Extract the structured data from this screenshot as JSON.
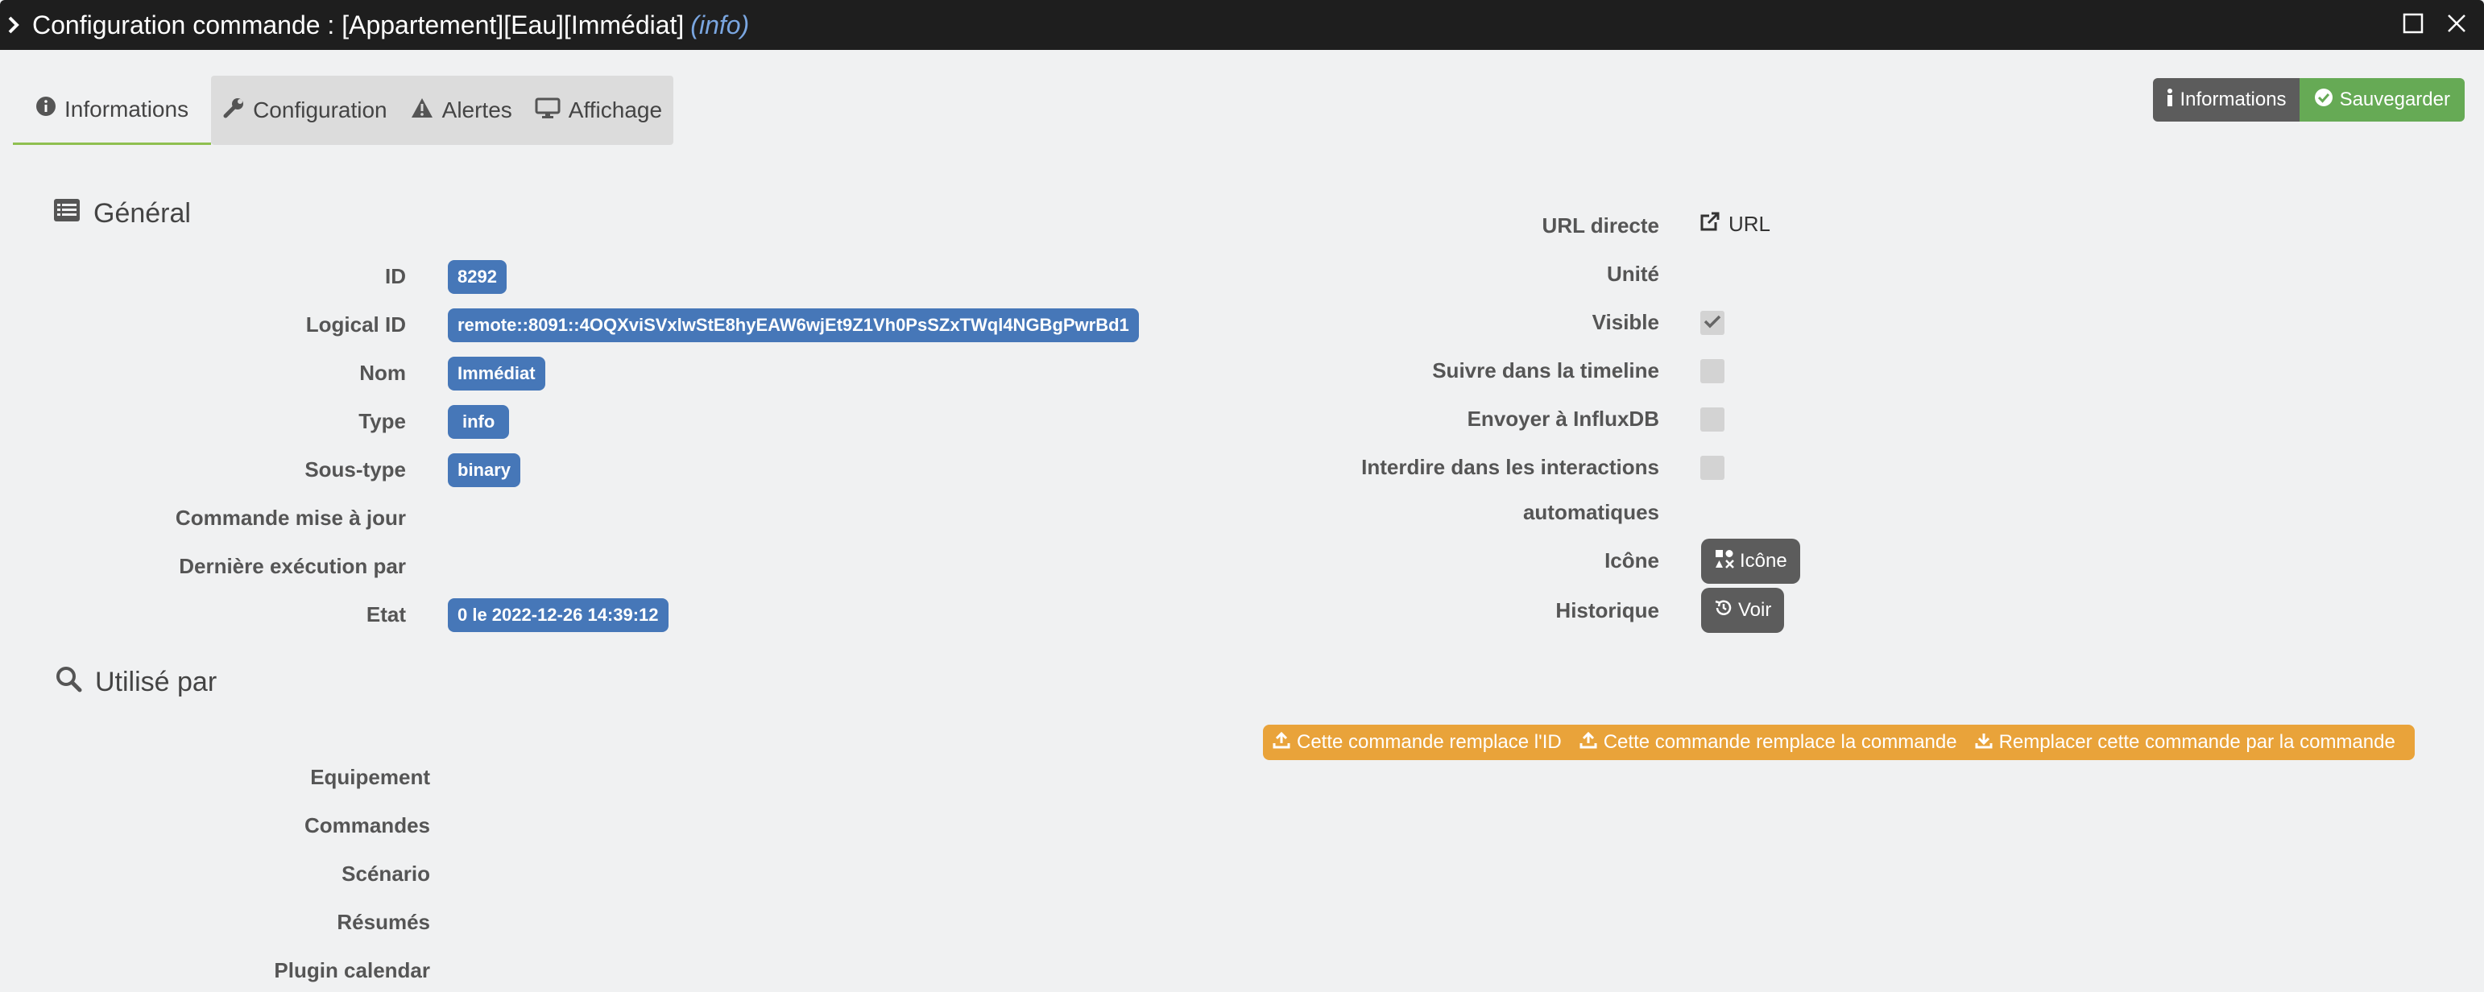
{
  "window": {
    "title": "Configuration commande : [Appartement][Eau][Immédiat]",
    "subtype": "(info)"
  },
  "tabs": [
    {
      "label": "Informations",
      "icon": "info-circle-icon"
    },
    {
      "label": "Configuration",
      "icon": "wrench-icon"
    },
    {
      "label": "Alertes",
      "icon": "warning-icon"
    },
    {
      "label": "Affichage",
      "icon": "monitor-icon"
    }
  ],
  "actions": {
    "info_label": "Informations",
    "save_label": "Sauvegarder"
  },
  "general": {
    "title": "Général",
    "fields": [
      {
        "label": "ID",
        "value": "8292"
      },
      {
        "label": "Logical ID",
        "value": "remote::8091::4OQXviSVxlwStE8hyEAW6wjEt9Z1Vh0PsSZxTWql4NGBgPwrBd1"
      },
      {
        "label": "Nom",
        "value": "Immédiat"
      },
      {
        "label": "Type",
        "value": "info"
      },
      {
        "label": "Sous-type",
        "value": "binary"
      },
      {
        "label": "Commande mise à jour",
        "value": ""
      },
      {
        "label": "Dernière exécution par",
        "value": ""
      },
      {
        "label": "Etat",
        "value": "0 le 2022-12-26 14:39:12"
      }
    ]
  },
  "right": {
    "url_label": "URL directe",
    "url_link": "URL",
    "unit_label": "Unité",
    "visible_label": "Visible",
    "visible_checked": true,
    "timeline_label": "Suivre dans la timeline",
    "influx_label": "Envoyer à InfluxDB",
    "interdire_label_1": "Interdire dans les interactions",
    "interdire_label_2": "automatiques",
    "icone_label": "Icône",
    "icone_button": "Icône",
    "historique_label": "Historique",
    "historique_button": "Voir"
  },
  "used_by": {
    "title": "Utilisé par",
    "rows": [
      "Equipement",
      "Commandes",
      "Scénario",
      "Résumés",
      "Plugin calendar"
    ],
    "replace_id": "Cette commande remplace l'ID",
    "replace_cmd": "Cette commande remplace la commande",
    "replace_by": "Remplacer cette commande par la commande"
  },
  "colors": {
    "title_bar": "#1e1e1e",
    "pill_blue": "#4677b8",
    "save_green": "#66aa55",
    "dark_button": "#5c5c5c",
    "orange": "#e9a33a",
    "tab_underline": "#8fbf50"
  }
}
